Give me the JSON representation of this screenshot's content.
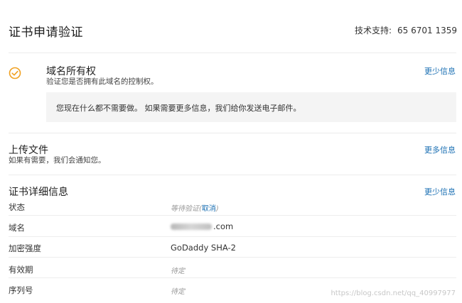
{
  "header": {
    "title": "证书申请验证",
    "support_label": "技术支持:",
    "support_number": "65 6701 1359"
  },
  "domain_ownership": {
    "title": "域名所有权",
    "subtitle": "验证您是否拥有此域名的控制权。",
    "toggle_label": "更少信息",
    "notice": "您现在什么都不需要做。 如果需要更多信息，我们给你发送电子邮件。",
    "status_icon": "check-circle-icon",
    "accent_color": "#f0a020"
  },
  "upload": {
    "title": "上传文件",
    "subtitle": "如果有需要，我们会通知您。",
    "toggle_label": "更多信息"
  },
  "details": {
    "title": "证书详细信息",
    "toggle_label": "更少信息",
    "rows": [
      {
        "label": "状态",
        "value": "等待验证",
        "action": "取消"
      },
      {
        "label": "域名",
        "value": ".com"
      },
      {
        "label": "加密强度",
        "value": "GoDaddy SHA-2"
      },
      {
        "label": "有效期",
        "value": "待定"
      },
      {
        "label": "序列号",
        "value": "待定"
      }
    ]
  },
  "watermark": "https://blog.csdn.net/qq_40997977"
}
